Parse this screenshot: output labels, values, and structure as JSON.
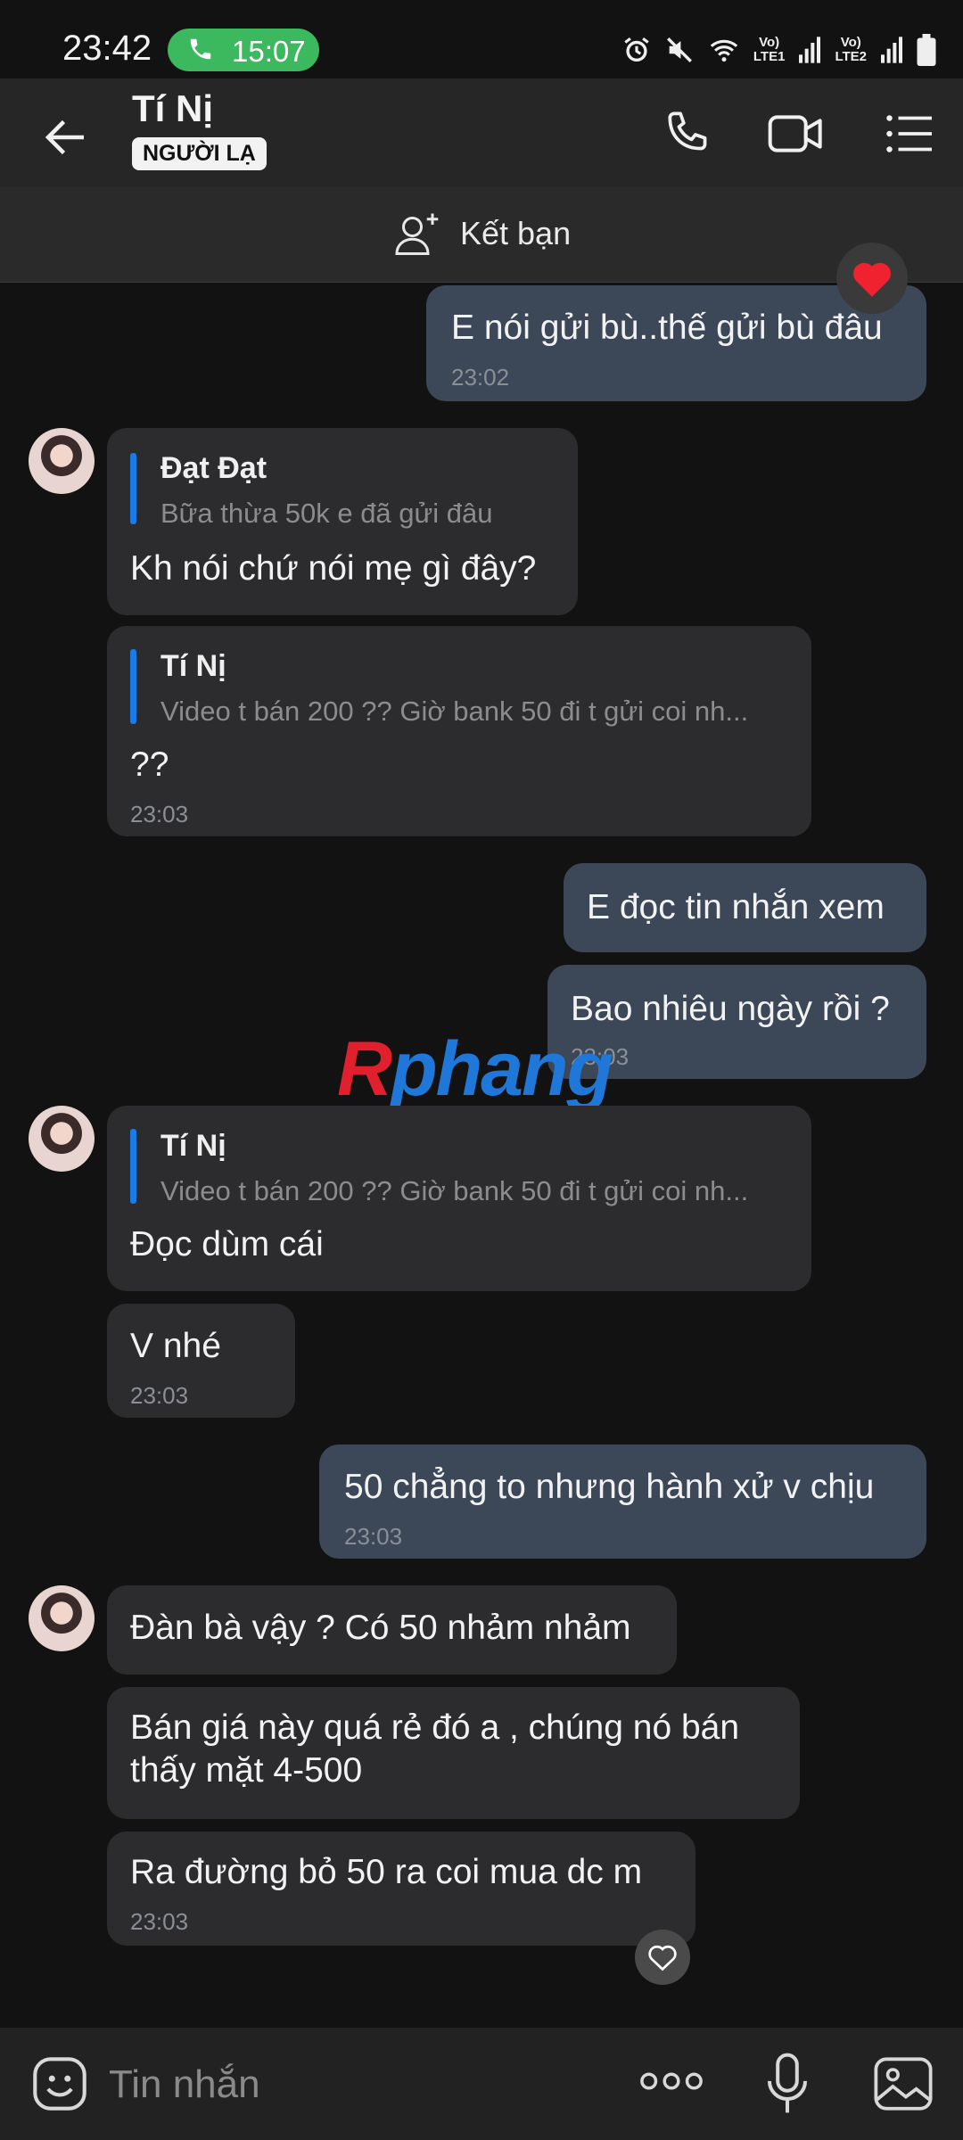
{
  "status_bar": {
    "time": "23:42",
    "call_timer": "15:07",
    "sim1": "LTE1",
    "sim2": "LTE2",
    "volte": "Vo)"
  },
  "header": {
    "contact_name": "Tí Nị",
    "stranger_badge": "NGƯỜI LẠ"
  },
  "friend_bar": {
    "label": "Kết bạn"
  },
  "messages": [
    {
      "dir": "out",
      "text": "E nói gửi bù..thế gửi bù đâu",
      "time": "23:02",
      "reaction": "heart"
    },
    {
      "dir": "in",
      "quote_author": "Đạt Đạt",
      "quote_text": "Bữa thừa 50k e đã gửi đâu",
      "text": "Kh nói chứ nói mẹ gì đây?"
    },
    {
      "dir": "in",
      "quote_author": "Tí Nị",
      "quote_text": "Video t bán 200 ??  Giờ bank 50 đi t gửi coi nh...",
      "text": "??",
      "time": "23:03"
    },
    {
      "dir": "out",
      "text": "E đọc tin nhắn xem"
    },
    {
      "dir": "out",
      "text": "Bao nhiêu ngày rồi ?",
      "time": "23:03"
    },
    {
      "dir": "in",
      "quote_author": "Tí Nị",
      "quote_text": "Video t bán 200 ??  Giờ bank 50 đi t gửi coi nh...",
      "text": "Đọc dùm cái"
    },
    {
      "dir": "in",
      "text": "V nhé",
      "time": "23:03"
    },
    {
      "dir": "out",
      "text": "50 chẳng to nhưng hành xử v chịu",
      "time": "23:03"
    },
    {
      "dir": "in",
      "text": "Đàn bà vậy ? Có 50 nhảm nhảm"
    },
    {
      "dir": "in",
      "text_line1": "Bán giá này quá rẻ đó a , chúng nó bán",
      "text_line2": "thấy mặt 4-500"
    },
    {
      "dir": "in",
      "text": "Ra đường bỏ 50 ra coi mua dc m",
      "time": "23:03"
    }
  ],
  "watermark": {
    "part1": "R",
    "part2": "phang"
  },
  "input_bar": {
    "placeholder": "Tin nhắn"
  },
  "colors": {
    "incoming_bubble": "#2c2c2e",
    "outgoing_bubble": "#3c4858",
    "quote_bar": "#1a7ae6",
    "call_pill": "#3cb85f",
    "background": "#121212"
  },
  "icons": [
    "back-arrow-icon",
    "phone-icon",
    "video-camera-icon",
    "list-menu-icon",
    "add-friend-icon",
    "heart-icon",
    "emoji-icon",
    "more-dots-icon",
    "microphone-icon",
    "image-icon"
  ]
}
